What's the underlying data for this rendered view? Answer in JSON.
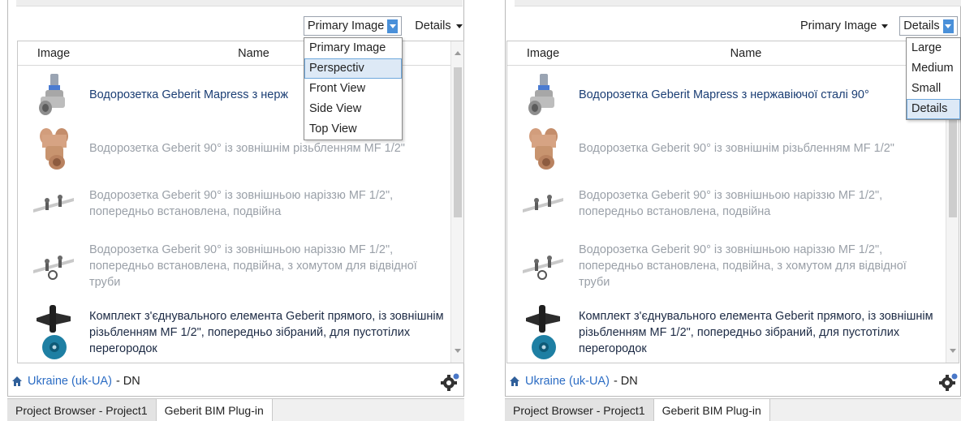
{
  "columns": {
    "image": "Image",
    "name": "Name"
  },
  "items": [
    {
      "name": "Водорозетка Geberit Mapress з нержавіючої сталі 90°",
      "name_truncated": "Водорозетка Geberit Mapress з нерж",
      "icon": "wall-elbow-steel-icon"
    },
    {
      "name": "Водорозетка Geberit 90° із зовнішнім різьбленням MF 1/2\"",
      "icon": "wall-elbow-bronze-icon"
    },
    {
      "name": "Водорозетка Geberit 90° із зовнішньою наріззю MF 1/2\", попередньо встановлена, подвійна",
      "icon": "double-wall-plate-icon"
    },
    {
      "name": "Водорозетка Geberit 90° із зовнішньою наріззю MF 1/2\", попередньо встановлена, подвійна, з хомутом для відвідної труби",
      "icon": "double-wall-plate-clamp-icon"
    },
    {
      "name": "Комплект з'єднувального елемента Geberit прямого, із зовнішнім різьбленням MF 1/2\", попередньо зібраний, для пустотілих перегородок",
      "icon": "connector-set-icon"
    }
  ],
  "left_panel": {
    "image_dropdown": {
      "label": "Primary Image",
      "options": [
        "Primary Image",
        "Perspectiv",
        "Front View",
        "Side View",
        "Top View"
      ],
      "highlighted": "Perspectiv"
    },
    "view_dropdown": {
      "label": "Details"
    }
  },
  "right_panel": {
    "image_dropdown": {
      "label": "Primary Image"
    },
    "view_dropdown": {
      "label": "Details",
      "options": [
        "Large",
        "Medium",
        "Small",
        "Details"
      ],
      "highlighted": "Details"
    }
  },
  "footer": {
    "region_link": "Ukraine (uk-UA)",
    "suffix": "- DN"
  },
  "tabs": [
    "Project Browser - Project1",
    "Geberit BIM Plug-in"
  ],
  "colors": {
    "link": "#2b6cc4",
    "highlight": "#4a90d9",
    "item_text": "#1b3e74",
    "dim_text": "#9aa0a8"
  }
}
